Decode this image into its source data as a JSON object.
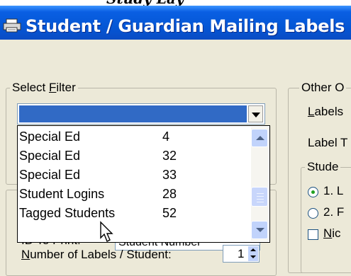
{
  "window": {
    "title": "Student / Guardian Mailing Labels"
  },
  "select_filter": {
    "legend_prefix": "Select ",
    "legend_accel": "F",
    "legend_suffix": "ilter",
    "dropdown_items": [
      {
        "name": "Special Ed",
        "count": "4"
      },
      {
        "name": "Special Ed",
        "count": "32"
      },
      {
        "name": "Special Ed",
        "count": "33"
      },
      {
        "name": "Student Logins",
        "count": "28"
      },
      {
        "name": "Tagged Students",
        "count": "52"
      }
    ]
  },
  "id_print": {
    "label": "ID To Print:",
    "value": "Student Number"
  },
  "labels_per_student": {
    "accel": "N",
    "label_rest": "umber of Labels / Student:",
    "value": "1"
  },
  "other_options": {
    "legend": "Other O",
    "labels_accel": "L",
    "labels_rest": "abels",
    "label_type": "Label T",
    "student_group": "Stude",
    "radio1": "1. L",
    "radio2": "2. F",
    "check_accel": "N",
    "check_rest": "ic"
  }
}
